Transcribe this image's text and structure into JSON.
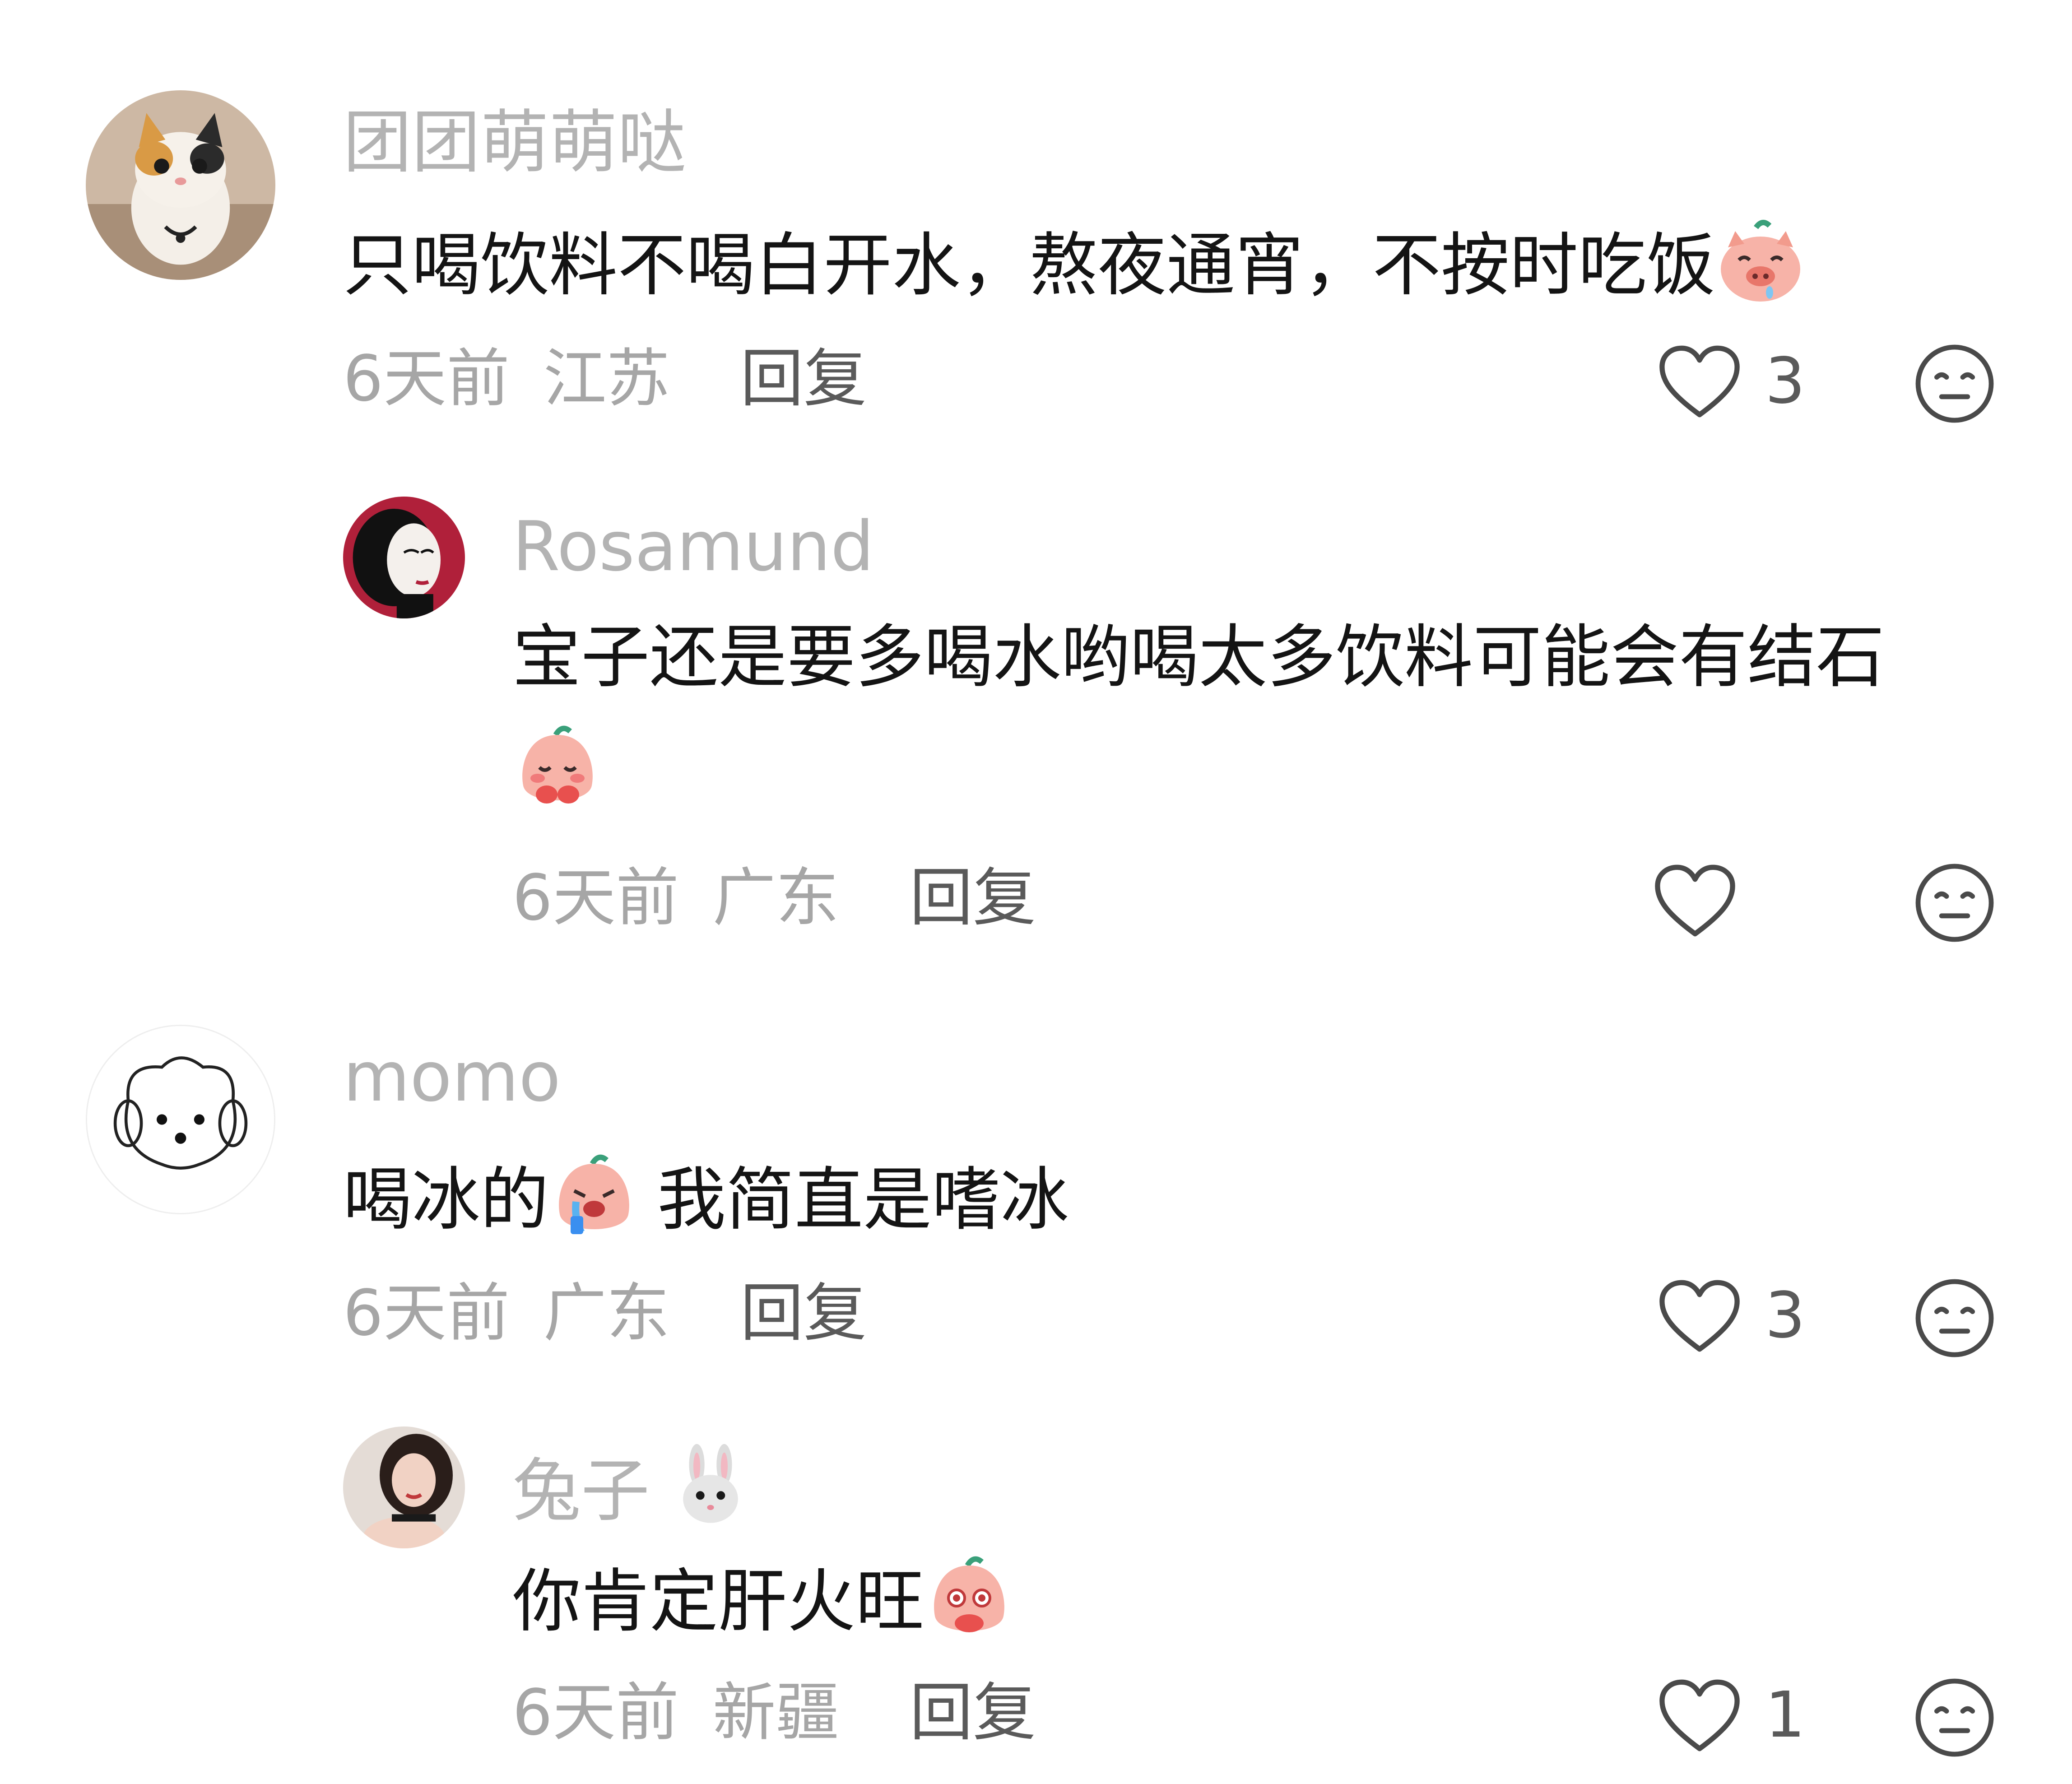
{
  "comments": [
    {
      "username": "团团萌萌哒",
      "avatar": "cat-avatar",
      "text_before": "只喝饮料不喝白开水，熬夜通宵，不按时吃饭",
      "emoji": "pig-drool-emoji",
      "time": "6天前",
      "location": "江苏",
      "reply_label": "回复",
      "likes": "3",
      "replies": [
        {
          "username": "Rosamund",
          "avatar": "illustrated-woman-avatar",
          "text": "宝子还是要多喝水哟喝太多饮料可能会有结石",
          "emoji": "peach-shy-emoji",
          "time": "6天前",
          "location": "广东",
          "reply_label": "回复",
          "likes": ""
        }
      ]
    },
    {
      "username": "momo",
      "avatar": "dog-doodle-avatar",
      "text_before": "喝冰的",
      "emoji": "peach-cry-emoji",
      "text_after": "我简直是嗜冰",
      "time": "6天前",
      "location": "广东",
      "reply_label": "回复",
      "likes": "3",
      "replies": [
        {
          "username": "兔子",
          "name_emoji": "rabbit-emoji",
          "avatar": "woman-photo-avatar",
          "text": "你肯定肝火旺",
          "emoji": "peach-shock-emoji",
          "time": "6天前",
          "location": "新疆",
          "reply_label": "回复",
          "likes": "1"
        }
      ]
    }
  ],
  "colors": {
    "username": "#b3b3b3",
    "text": "#141414",
    "meta": "#a6a6a6",
    "reply": "#5a5a5a",
    "icon": "#4a4a4a"
  }
}
